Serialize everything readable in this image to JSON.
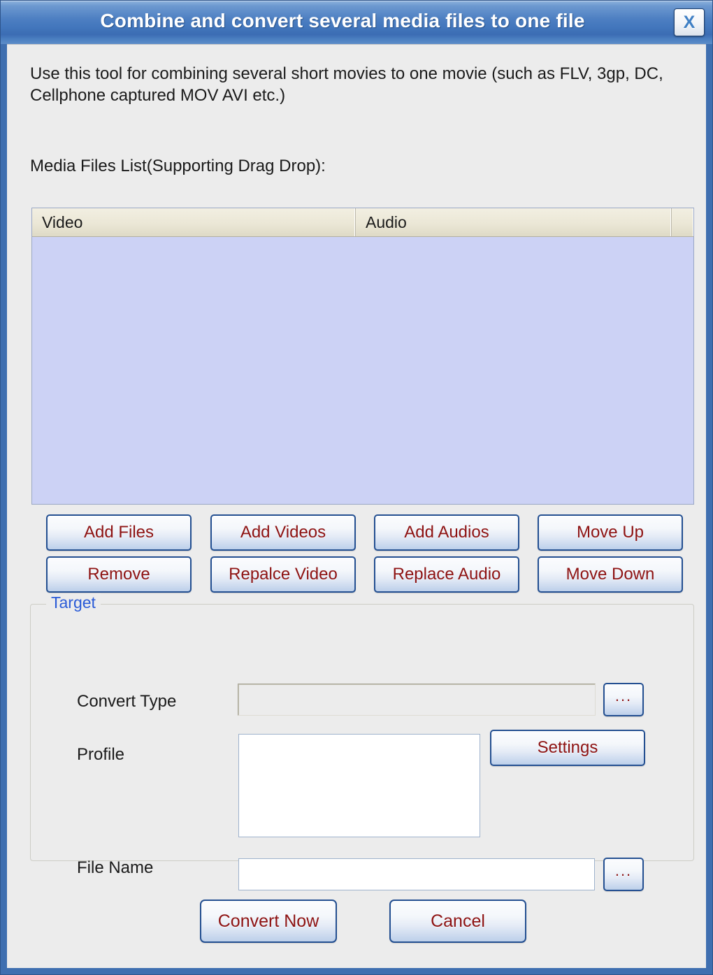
{
  "window": {
    "title": "Combine and convert several media files to one file",
    "close_label": "X",
    "close_icon": "close-icon",
    "frame_color": "#3f6fb0",
    "title_color": "#ffffff"
  },
  "content": {
    "intro_text": "Use this tool for combining several short movies to one movie (such as FLV, 3gp, DC, Cellphone captured MOV AVI etc.)",
    "list_label": "Media Files List(Supporting Drag  Drop):"
  },
  "media_list": {
    "columns": [
      "Video",
      "Audio",
      ""
    ],
    "rows": [],
    "body_color": "#ccd2f5",
    "header_color": "#ebe7d6"
  },
  "operations": {
    "buttons": [
      {
        "label": "Add Files"
      },
      {
        "label": "Add Videos"
      },
      {
        "label": "Add Audios"
      },
      {
        "label": "Move Up"
      },
      {
        "label": "Remove"
      },
      {
        "label": "Repalce Video"
      },
      {
        "label": "Replace Audio"
      },
      {
        "label": "Move Down"
      }
    ],
    "text_color": "#8d1212"
  },
  "target": {
    "group_title": "Target",
    "group_title_color": "#2a5bd7",
    "convert_type": {
      "label": "Convert Type",
      "value": "",
      "browse_label": "..."
    },
    "profile": {
      "label": "Profile",
      "value": "",
      "options": []
    },
    "settings_label": "Settings",
    "file_name": {
      "label": "File Name",
      "value": "",
      "placeholder": "",
      "browse_label": "..."
    }
  },
  "footer": {
    "convert_label": "Convert Now",
    "cancel_label": "Cancel"
  }
}
